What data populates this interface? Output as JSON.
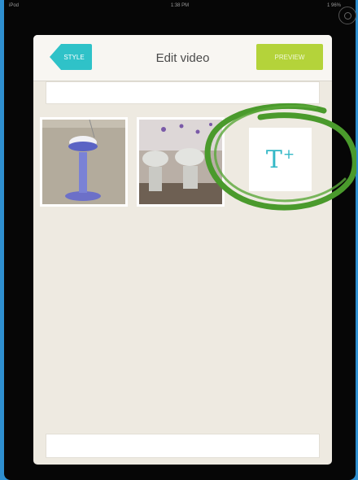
{
  "status_bar": {
    "carrier": "iPod",
    "time": "1:38 PM",
    "battery": "1 96%"
  },
  "header": {
    "back_label": "STYLE",
    "title": "Edit video",
    "preview_label": "PREVIEW"
  },
  "top_bar": {
    "label": ""
  },
  "bottom_bar": {
    "label": ""
  },
  "clips": [
    {
      "name": "clip-stool"
    },
    {
      "name": "clip-chairs"
    }
  ],
  "add_text": {
    "glyph": "T",
    "plus": "+"
  },
  "colors": {
    "accent_teal": "#2fc2c8",
    "accent_lime": "#b4d33a",
    "annotation_green": "#4a9a2c",
    "canvas": "#eeeae1"
  }
}
